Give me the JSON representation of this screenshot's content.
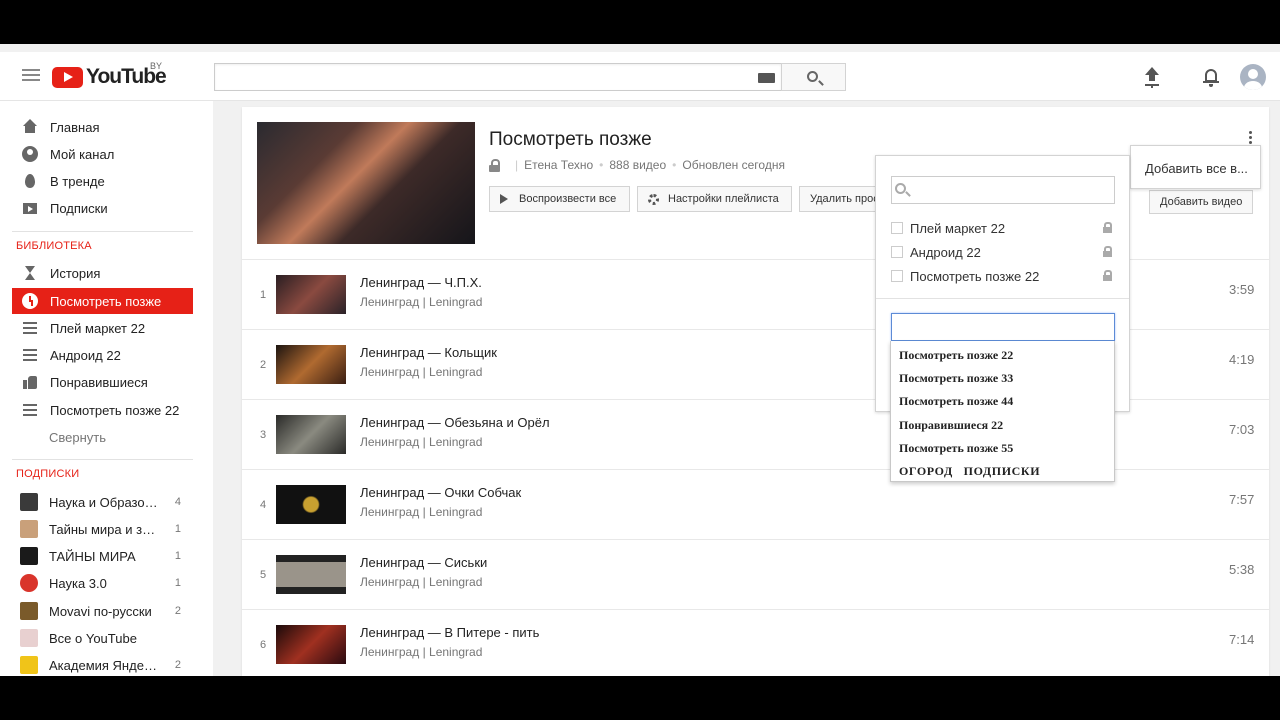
{
  "masthead": {
    "logo_text": "YouTube",
    "region": "BY",
    "search_placeholder": ""
  },
  "sidebar": {
    "main": [
      {
        "label": "Главная",
        "icon": "home-icon"
      },
      {
        "label": "Мой канал",
        "icon": "user-icon"
      },
      {
        "label": "В тренде",
        "icon": "fire-icon"
      },
      {
        "label": "Подписки",
        "icon": "subscriptions-icon"
      }
    ],
    "library_title": "БИБЛИОТЕКА",
    "library": [
      {
        "label": "История",
        "icon": "history-icon"
      },
      {
        "label": "Посмотреть позже",
        "icon": "clock-icon",
        "active": true
      },
      {
        "label": "Плей маркет 22",
        "icon": "playlist-icon"
      },
      {
        "label": "Андроид 22",
        "icon": "playlist-icon"
      },
      {
        "label": "Понравившиеся",
        "icon": "thumb-up-icon"
      },
      {
        "label": "Посмотреть позже 22",
        "icon": "playlist-icon"
      }
    ],
    "collapse_label": "Свернуть",
    "subs_title": "ПОДПИСКИ",
    "subscriptions": [
      {
        "label": "Наука и Образов…",
        "count": "4",
        "color": "#3a3a3a"
      },
      {
        "label": "Тайны мира и за…",
        "count": "1",
        "color": "#c9a07a"
      },
      {
        "label": "ТАЙНЫ МИРА",
        "count": "1",
        "color": "#1a1a1a"
      },
      {
        "label": "Наука 3.0",
        "count": "1",
        "color": "#d9342b"
      },
      {
        "label": "Movavi по-русски",
        "count": "2",
        "color": "#7a5a2a"
      },
      {
        "label": "Все о YouTube",
        "count": "",
        "color": "#e8d0d0"
      },
      {
        "label": "Академия Яндек…",
        "count": "2",
        "color": "#f0c419"
      }
    ]
  },
  "playlist": {
    "title": "Посмотреть позже",
    "owner": "Етена Техно",
    "video_count": "888 видео",
    "updated": "Обновлен сегодня",
    "play_all": "Воспроизвести все",
    "settings": "Настройки плейлиста",
    "delete": "Удалить просм",
    "add_video": "Добавить видео",
    "add_all": "Добавить все в..."
  },
  "videos": [
    {
      "index": "1",
      "title": "Ленинград — Ч.П.Х.",
      "channel": "Ленинград | Leningrad",
      "duration": "3:59",
      "thumb": "#3b2a2a"
    },
    {
      "index": "2",
      "title": "Ленинград — Кольщик",
      "channel": "Ленинград | Leningrad",
      "duration": "4:19",
      "thumb": "#5a3a22"
    },
    {
      "index": "3",
      "title": "Ленинград — Обезьяна и Орёл",
      "channel": "Ленинград | Leningrad",
      "duration": "7:03",
      "thumb": "#4a4a48"
    },
    {
      "index": "4",
      "title": "Ленинград — Очки Собчак",
      "channel": "Ленинград | Leningrad",
      "duration": "7:57",
      "thumb": "#111111"
    },
    {
      "index": "5",
      "title": "Ленинград — Сиськи",
      "channel": "Ленинград | Leningrad",
      "duration": "5:38",
      "thumb": "#6a6660"
    },
    {
      "index": "6",
      "title": "Ленинград — В Питере - пить",
      "channel": "Ленинград | Leningrad",
      "duration": "7:14",
      "thumb": "#5a2020"
    }
  ],
  "popover": {
    "search_value": "",
    "playlists": [
      {
        "label": "Плей маркет 22"
      },
      {
        "label": "Андроид 22"
      },
      {
        "label": "Посмотреть позже 22"
      }
    ],
    "new_playlist_value": "",
    "suggestions": [
      "Посмотреть позже 22",
      "Посмотреть позже 33",
      "Посмотреть позже 44",
      "Понравившиеся 22",
      "Посмотреть позже 55",
      "ОГОРОД   ПОДПИСКИ"
    ]
  },
  "colors": {
    "brand": "#e62117",
    "focus": "#5d8bd6"
  }
}
